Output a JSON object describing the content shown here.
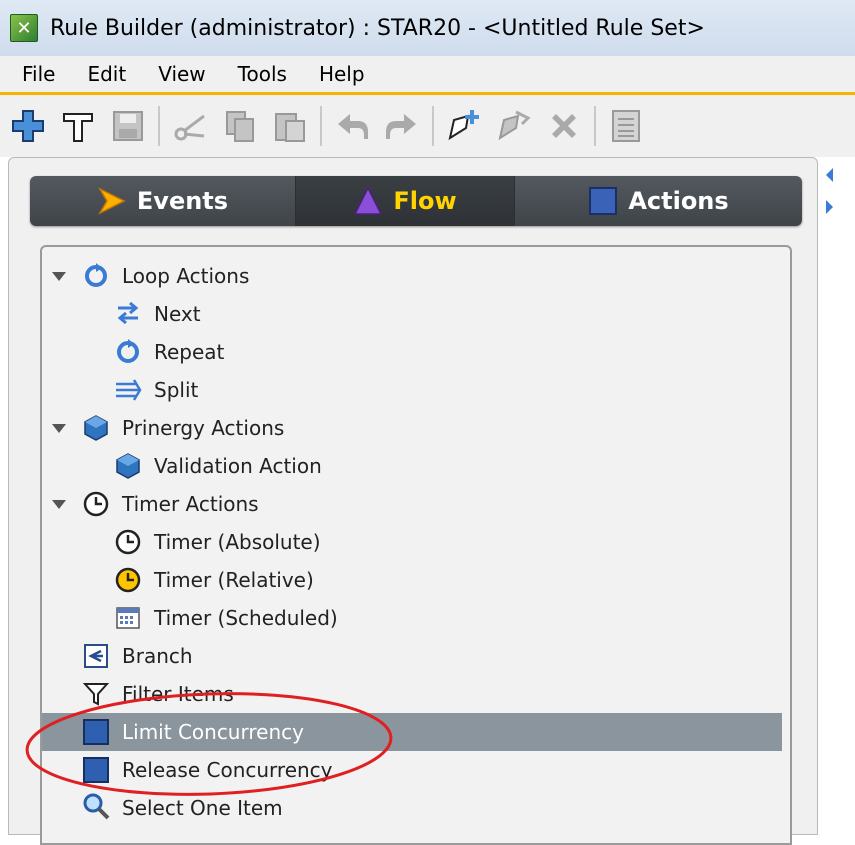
{
  "window": {
    "title": "Rule Builder (administrator) : STAR20 - <Untitled Rule Set>"
  },
  "menu": [
    "File",
    "Edit",
    "View",
    "Tools",
    "Help"
  ],
  "toolbar": {
    "icons": [
      "add-icon",
      "build-hammer-icon",
      "save-icon",
      "cut-icon",
      "copy-icon",
      "paste-icon",
      "undo-icon",
      "redo-icon",
      "new-star-icon",
      "export-star-icon",
      "delete-icon",
      "list-icon"
    ]
  },
  "tabs": [
    {
      "label": "Events",
      "icon": "events-arrow-icon"
    },
    {
      "label": "Flow",
      "icon": "flow-triangle-icon",
      "active": true
    },
    {
      "label": "Actions",
      "icon": "actions-square-icon"
    }
  ],
  "tree": [
    {
      "label": "Loop Actions",
      "icon": "loop-icon",
      "level": 0,
      "expanded": true
    },
    {
      "label": "Next",
      "icon": "next-arrow-icon",
      "level": 1
    },
    {
      "label": "Repeat",
      "icon": "repeat-icon",
      "level": 1
    },
    {
      "label": "Split",
      "icon": "split-icon",
      "level": 1
    },
    {
      "label": "Prinergy Actions",
      "icon": "prinergy-hex-icon",
      "level": 0,
      "expanded": true
    },
    {
      "label": "Validation Action",
      "icon": "validation-hex-icon",
      "level": 1
    },
    {
      "label": "Timer Actions",
      "icon": "clock-icon",
      "level": 0,
      "expanded": true
    },
    {
      "label": "Timer (Absolute)",
      "icon": "clock-icon",
      "level": 1
    },
    {
      "label": "Timer (Relative)",
      "icon": "clock-relative-icon",
      "level": 1
    },
    {
      "label": "Timer (Scheduled)",
      "icon": "calendar-icon",
      "level": 1
    },
    {
      "label": "Branch",
      "icon": "branch-icon",
      "level": 0
    },
    {
      "label": "Filter Items",
      "icon": "filter-icon",
      "level": 0
    },
    {
      "label": "Limit Concurrency",
      "icon": "blue-square-icon",
      "level": 0,
      "selected": true
    },
    {
      "label": "Release Concurrency",
      "icon": "blue-square-icon",
      "level": 0
    },
    {
      "label": "Select One Item",
      "icon": "magnifier-icon",
      "level": 0
    }
  ],
  "colors": {
    "accent": "#f5b400",
    "selection": "#8a959e",
    "annotation": "#e02020"
  }
}
